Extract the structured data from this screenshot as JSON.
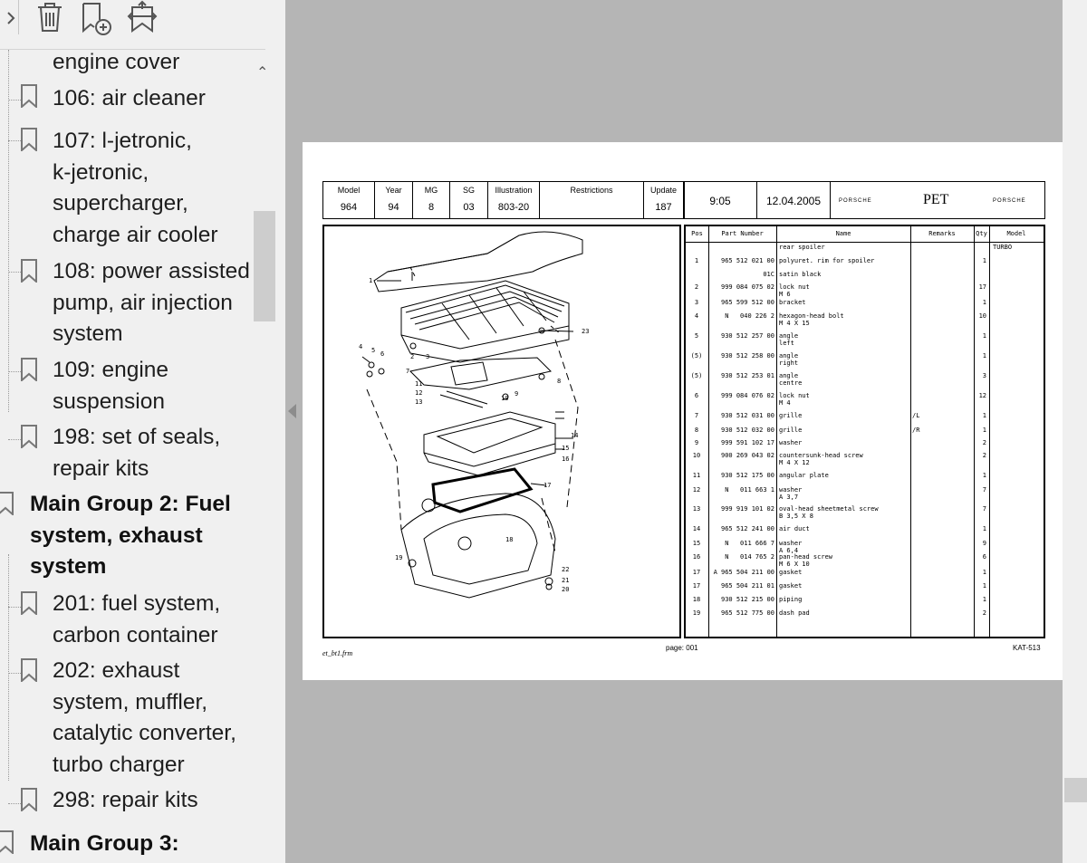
{
  "sidebar": {
    "toolbar": [
      {
        "icon": "delete-bookmark-icon"
      },
      {
        "icon": "add-bookmark-icon"
      },
      {
        "icon": "expand-bookmark-icon"
      }
    ],
    "items": [
      {
        "label": "engine cover",
        "level": 1,
        "icon": false
      },
      {
        "label": "106: air cleaner",
        "level": 1,
        "icon": true
      },
      {
        "label": "107: l-jetronic,\nk-jetronic,\nsupercharger,\ncharge air cooler",
        "level": 1,
        "icon": true
      },
      {
        "label": "108: power assisted\npump, air injection\nsystem",
        "level": 1,
        "icon": true
      },
      {
        "label": "109: engine\nsuspension",
        "level": 1,
        "icon": true
      },
      {
        "label": "198: set of seals,\nrepair kits",
        "level": 1,
        "icon": true
      },
      {
        "label": "Main Group 2: Fuel\nsystem, exhaust\nsystem",
        "level": 0,
        "icon": true
      },
      {
        "label": "201: fuel system,\ncarbon container",
        "level": 1,
        "icon": true
      },
      {
        "label": "202: exhaust\nsystem, muffler,\ncatalytic converter,\nturbo charger",
        "level": 1,
        "icon": true
      },
      {
        "label": "298: repair kits",
        "level": 1,
        "icon": true
      },
      {
        "label": "Main Group 3:",
        "level": 0,
        "icon": true
      }
    ]
  },
  "document": {
    "header": {
      "model_caption": "Model",
      "model": "964",
      "year_caption": "Year",
      "year": "94",
      "mg_caption": "MG",
      "mg": "8",
      "sg_caption": "SG",
      "sg": "03",
      "illustration_caption": "Illustration",
      "illustration": "803-20",
      "restrictions_caption": "Restrictions",
      "restrictions": "",
      "update_caption": "Update",
      "update": "187",
      "time": "9:05",
      "date": "12.04.2005",
      "brand_left": "PORSCHE",
      "system": "PET",
      "brand_right": "PORSCHE"
    },
    "table": {
      "columns": [
        "Pos",
        "Part Number",
        "Name",
        "Remarks",
        "Qty",
        "Model"
      ],
      "rows": [
        {
          "pos": "",
          "pn": "",
          "name": "rear spoiler",
          "rem": "",
          "qty": "",
          "model": "TURBO"
        },
        {
          "pos": "1",
          "pn": "965 512 021 00",
          "name": "polyuret. rim for spoiler",
          "rem": "",
          "qty": "1",
          "model": ""
        },
        {
          "pos": "",
          "pn": "01C",
          "name": "satin black",
          "rem": "",
          "qty": "",
          "model": ""
        },
        {
          "pos": "2",
          "pn": "999 084 075 02",
          "name": "lock nut\nM 6",
          "rem": "",
          "qty": "17",
          "model": ""
        },
        {
          "pos": "3",
          "pn": "965 599 512 00",
          "name": "bracket",
          "rem": "",
          "qty": "1",
          "model": ""
        },
        {
          "pos": "4",
          "pn": "N   040 226 2",
          "name": "hexagon-head bolt\nM 4 X 15",
          "rem": "",
          "qty": "10",
          "model": ""
        },
        {
          "pos": "5",
          "pn": "930 512 257 00",
          "name": "angle\nleft",
          "rem": "",
          "qty": "1",
          "model": ""
        },
        {
          "pos": "(5)",
          "pn": "930 512 258 00",
          "name": "angle\nright",
          "rem": "",
          "qty": "1",
          "model": ""
        },
        {
          "pos": "(5)",
          "pn": "930 512 253 01",
          "name": "angle\ncentre",
          "rem": "",
          "qty": "3",
          "model": ""
        },
        {
          "pos": "6",
          "pn": "999 084 076 02",
          "name": "lock nut\nM 4",
          "rem": "",
          "qty": "12",
          "model": ""
        },
        {
          "pos": "7",
          "pn": "930 512 031 00",
          "name": "grille",
          "rem": "/L",
          "qty": "1",
          "model": ""
        },
        {
          "pos": "8",
          "pn": "930 512 032 00",
          "name": "grille",
          "rem": "/R",
          "qty": "1",
          "model": ""
        },
        {
          "pos": "9",
          "pn": "999 591 102 17",
          "name": "washer",
          "rem": "",
          "qty": "2",
          "model": ""
        },
        {
          "pos": "10",
          "pn": "900 269 043 02",
          "name": "countersunk-head screw\nM 4 X 12",
          "rem": "",
          "qty": "2",
          "model": ""
        },
        {
          "pos": "11",
          "pn": "930 512 175 00",
          "name": "angular plate",
          "rem": "",
          "qty": "1",
          "model": ""
        },
        {
          "pos": "12",
          "pn": "N   011 663 1",
          "name": "washer\nA 3,7",
          "rem": "",
          "qty": "7",
          "model": ""
        },
        {
          "pos": "13",
          "pn": "999 919 101 02",
          "name": "oval-head sheetmetal screw\nB 3,5 X 8",
          "rem": "",
          "qty": "7",
          "model": ""
        },
        {
          "pos": "14",
          "pn": "965 512 241 00",
          "name": "air duct",
          "rem": "",
          "qty": "1",
          "model": ""
        },
        {
          "pos": "15",
          "pn": "N   011 666 7",
          "name": "washer\nA 6,4",
          "rem": "",
          "qty": "9",
          "model": ""
        },
        {
          "pos": "16",
          "pn": "N   014 765 2",
          "name": "pan-head screw\nM 6 X 10",
          "rem": "",
          "qty": "6",
          "model": ""
        },
        {
          "pos": "17",
          "pn": "A 965 504 211 00",
          "name": "gasket",
          "rem": "",
          "qty": "1",
          "model": ""
        },
        {
          "pos": "17",
          "pn": "965 504 211 01",
          "name": "gasket",
          "rem": "",
          "qty": "1",
          "model": ""
        },
        {
          "pos": "18",
          "pn": "930 512 215 00",
          "name": "piping",
          "rem": "",
          "qty": "1",
          "model": ""
        },
        {
          "pos": "19",
          "pn": "965 512 775 00",
          "name": "dash pad",
          "rem": "",
          "qty": "2",
          "model": ""
        }
      ]
    },
    "diagram_callouts": [
      "1",
      "2",
      "3",
      "4",
      "5",
      "6",
      "7",
      "8",
      "9",
      "10",
      "11",
      "12",
      "13",
      "14",
      "15",
      "16",
      "17",
      "18",
      "19",
      "20",
      "21",
      "22",
      "23"
    ],
    "footer": {
      "file": "et_bt1.frm",
      "page": "page: 001",
      "catalog": "KAT-513"
    }
  }
}
